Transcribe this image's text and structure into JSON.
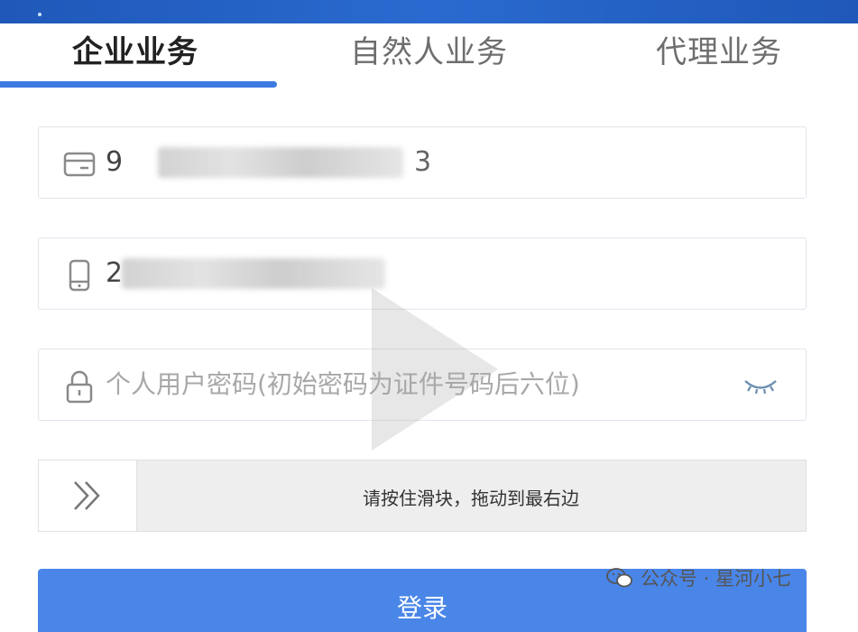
{
  "tabs": [
    {
      "label": "企业业务",
      "active": true
    },
    {
      "label": "自然人业务",
      "active": false
    },
    {
      "label": "代理业务",
      "active": false
    }
  ],
  "form": {
    "id_field": {
      "value_prefix": "9",
      "value_suffix": "3",
      "icon": "id-card-icon"
    },
    "phone_field": {
      "value_prefix": "2",
      "icon": "phone-icon"
    },
    "password_field": {
      "placeholder": "个人用户密码(初始密码为证件号码后六位)",
      "icon": "lock-icon",
      "toggle_icon": "eye-closed-icon"
    }
  },
  "slider": {
    "label": "请按住滑块，拖动到最右边",
    "icon": "double-chevron-right-icon"
  },
  "login": {
    "label": "登录"
  },
  "watermark": {
    "text": "公众号 · 星河小七",
    "icon": "wechat-icon"
  },
  "colors": {
    "accent": "#3d7be3",
    "button": "#4a86e8",
    "header": "#1f58b8"
  }
}
